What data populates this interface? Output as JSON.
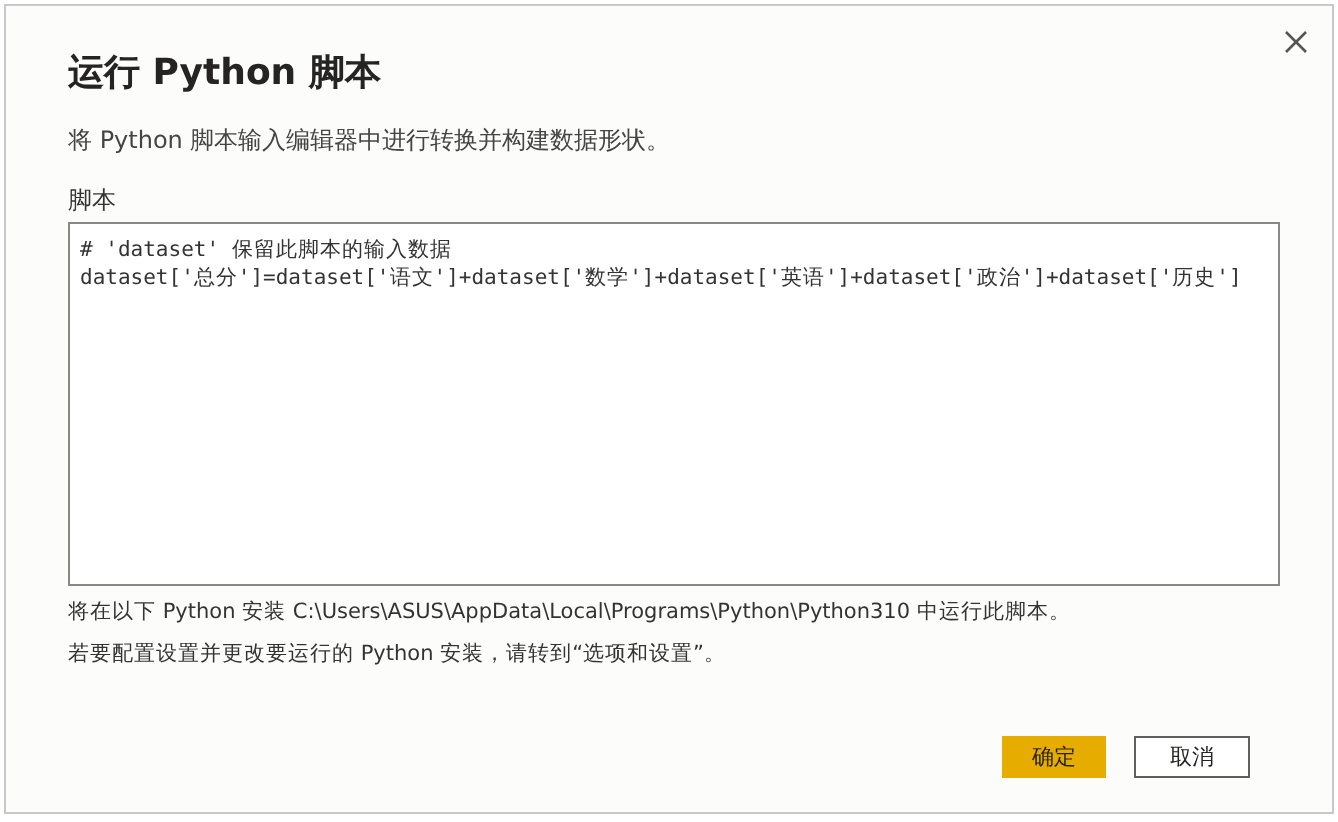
{
  "dialog": {
    "title": "运行 Python 脚本",
    "description": "将 Python 脚本输入编辑器中进行转换并构建数据形状。"
  },
  "script": {
    "label": "脚本",
    "lines": [
      "# 'dataset' 保留此脚本的输入数据",
      "dataset['总分']=dataset['语文']+dataset['数学']+dataset['英语']+dataset['政治']+dataset['历史']"
    ]
  },
  "notes": [
    "将在以下 Python 安装 C:\\Users\\ASUS\\AppData\\Local\\Programs\\Python\\Python310 中运行此脚本。",
    "若要配置设置并更改要运行的 Python 安装，请转到“选项和设置”。"
  ],
  "buttons": [
    {
      "label": "确定",
      "kind": "primary"
    },
    {
      "label": "取消",
      "kind": "secondary"
    }
  ]
}
